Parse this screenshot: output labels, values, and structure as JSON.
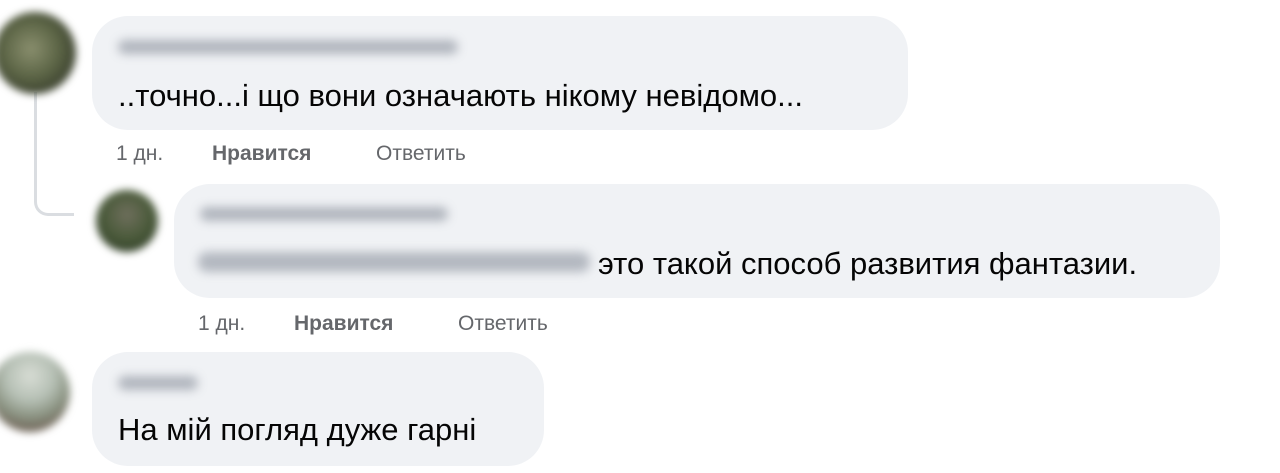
{
  "comments": [
    {
      "text": "..точно...і що вони означають нікому невідомо...",
      "time": "1 дн.",
      "like_label": "Нравится",
      "reply_label": "Ответить"
    },
    {
      "text": "это такой способ развития фантазии.",
      "time": "1 дн.",
      "like_label": "Нравится",
      "reply_label": "Ответить"
    },
    {
      "text": "На мій погляд дуже гарні"
    }
  ],
  "colors": {
    "bubble": "#f0f2f5",
    "action_text": "#65676b",
    "body_text": "#050505",
    "thread_line": "#dadde1"
  }
}
